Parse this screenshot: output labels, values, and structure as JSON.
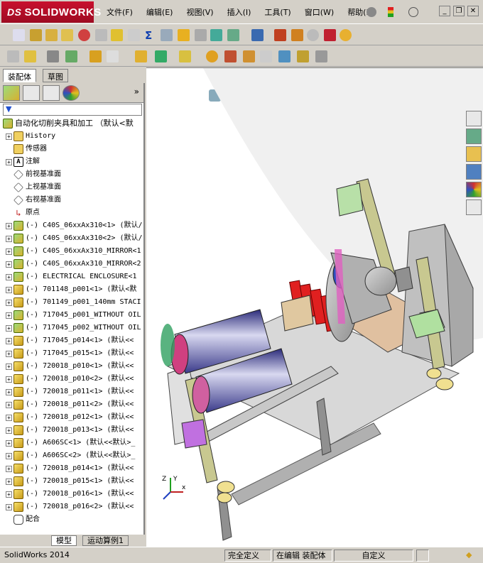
{
  "app": {
    "logo_prefix": "DS",
    "logo_text": "SOLIDWORKS"
  },
  "menu": [
    "文件(F)",
    "编辑(E)",
    "视图(V)",
    "插入(I)",
    "工具(T)",
    "窗口(W)",
    "帮助(H)"
  ],
  "panel_tabs": {
    "assembly": "装配体",
    "sketch": "草图"
  },
  "tree": {
    "root": "自动化切削夹具和加工 （默认<默",
    "items": [
      {
        "exp": "+",
        "icon": "folder",
        "label": "History"
      },
      {
        "exp": "",
        "icon": "folder",
        "label": "传感器"
      },
      {
        "exp": "+",
        "icon": "annotation",
        "label": "注解"
      },
      {
        "exp": "",
        "icon": "plane",
        "label": "前视基准面"
      },
      {
        "exp": "",
        "icon": "plane",
        "label": "上视基准面"
      },
      {
        "exp": "",
        "icon": "plane",
        "label": "右视基准面"
      },
      {
        "exp": "",
        "icon": "origin",
        "label": "原点"
      },
      {
        "exp": "+",
        "icon": "asm",
        "label": "(-) C40S_06xxAx310<1> (默认/"
      },
      {
        "exp": "+",
        "icon": "asm",
        "label": "(-) C40S_06xxAx310<2> (默认/"
      },
      {
        "exp": "+",
        "icon": "asm",
        "label": "(-) C40S_06xxAx310_MIRROR<1"
      },
      {
        "exp": "+",
        "icon": "asm",
        "label": "(-) C40S_06xxAx310_MIRROR<2"
      },
      {
        "exp": "+",
        "icon": "asm",
        "label": "(-) ELECTRICAL ENCLOSURE<1"
      },
      {
        "exp": "+",
        "icon": "part",
        "label": "(-) 701148_p001<1> (默认<默"
      },
      {
        "exp": "+",
        "icon": "part",
        "label": "(-) 701149_p001_140mm STACI"
      },
      {
        "exp": "+",
        "icon": "asm",
        "label": "(-) 717045_p001_WITHOUT OIL"
      },
      {
        "exp": "+",
        "icon": "asm",
        "label": "(-) 717045_p002_WITHOUT OIL"
      },
      {
        "exp": "+",
        "icon": "part",
        "label": "(-) 717045_p014<1> (默认<<"
      },
      {
        "exp": "+",
        "icon": "part",
        "label": "(-) 717045_p015<1> (默认<<"
      },
      {
        "exp": "+",
        "icon": "part",
        "label": "(-) 720018_p010<1> (默认<<"
      },
      {
        "exp": "+",
        "icon": "part",
        "label": "(-) 720018_p010<2> (默认<<"
      },
      {
        "exp": "+",
        "icon": "part",
        "label": "(-) 720018_p011<1> (默认<<"
      },
      {
        "exp": "+",
        "icon": "part",
        "label": "(-) 720018_p011<2> (默认<<"
      },
      {
        "exp": "+",
        "icon": "part",
        "label": "(-) 720018_p012<1> (默认<<"
      },
      {
        "exp": "+",
        "icon": "part",
        "label": "(-) 720018_p013<1> (默认<<"
      },
      {
        "exp": "+",
        "icon": "part",
        "label": "(-) A606SC<1> (默认<<默认>_"
      },
      {
        "exp": "+",
        "icon": "part",
        "label": "(-) A606SC<2> (默认<<默认>_"
      },
      {
        "exp": "+",
        "icon": "part",
        "label": "(-) 720018_p014<1> (默认<<"
      },
      {
        "exp": "+",
        "icon": "part",
        "label": "(-) 720018_p015<1> (默认<<"
      },
      {
        "exp": "+",
        "icon": "part",
        "label": "(-) 720018_p016<1> (默认<<"
      },
      {
        "exp": "+",
        "icon": "part",
        "label": "(-) 720018_p016<2> (默认<<"
      },
      {
        "exp": "",
        "icon": "mates",
        "label": "配合"
      }
    ]
  },
  "bottom_tabs": {
    "model": "模型",
    "motion": "运动算例1"
  },
  "status": {
    "app": "SolidWorks 2014",
    "defined": "完全定义",
    "editing": "在编辑 装配体",
    "custom": "自定义"
  },
  "triad": {
    "x": "x",
    "y": "Y",
    "z": "Z"
  },
  "colors": {
    "logo_red": "#c8102e",
    "panel_bg": "#d4d0c8"
  }
}
